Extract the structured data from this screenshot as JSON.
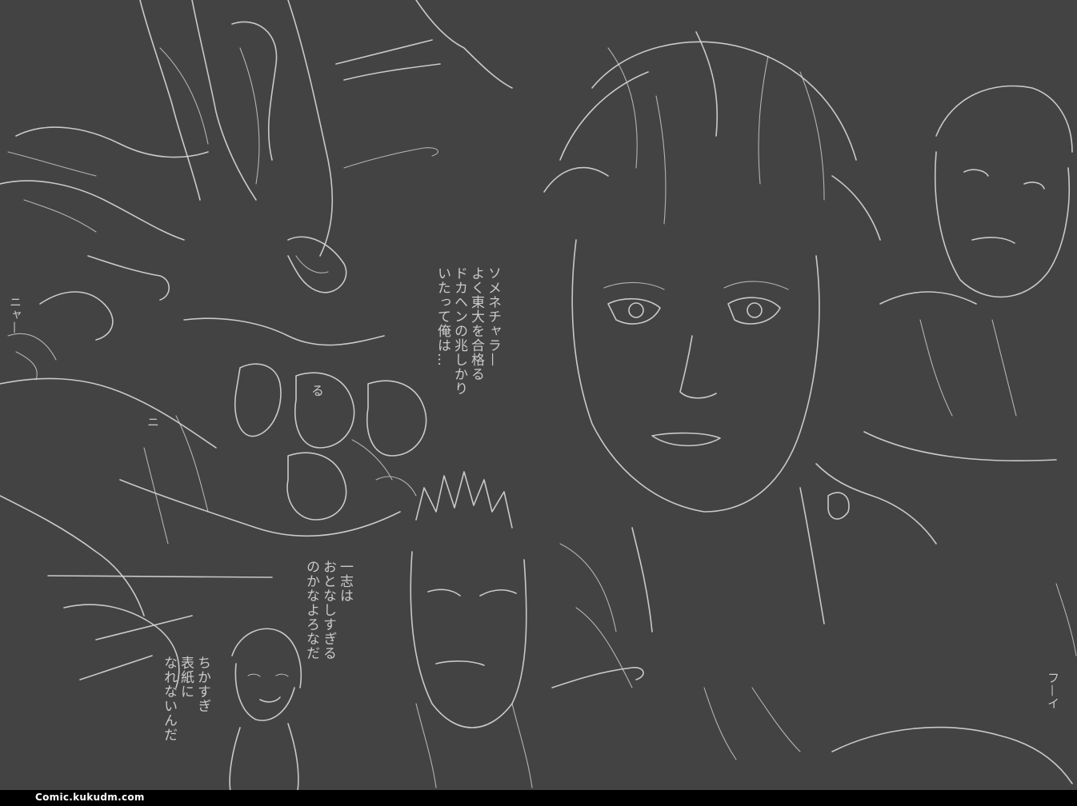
{
  "notes": {
    "a": "ソメネチャラ—\nよく東大を合格る\nドカヘンの兆しかり\nいたって俺は…",
    "b": "一志は\nおとなしすぎる\nのかなよろなだ",
    "c": "ちかすぎ\n表紙に\nなれないんだ",
    "d": "ニャ—",
    "e": "フ—イ",
    "f": "ニ",
    "g": "る"
  },
  "watermark": {
    "text": "Comic.kukudm.com"
  },
  "colors": {
    "paper": "#434343",
    "pencil": "#d8d8d8",
    "bar": "#000000"
  }
}
